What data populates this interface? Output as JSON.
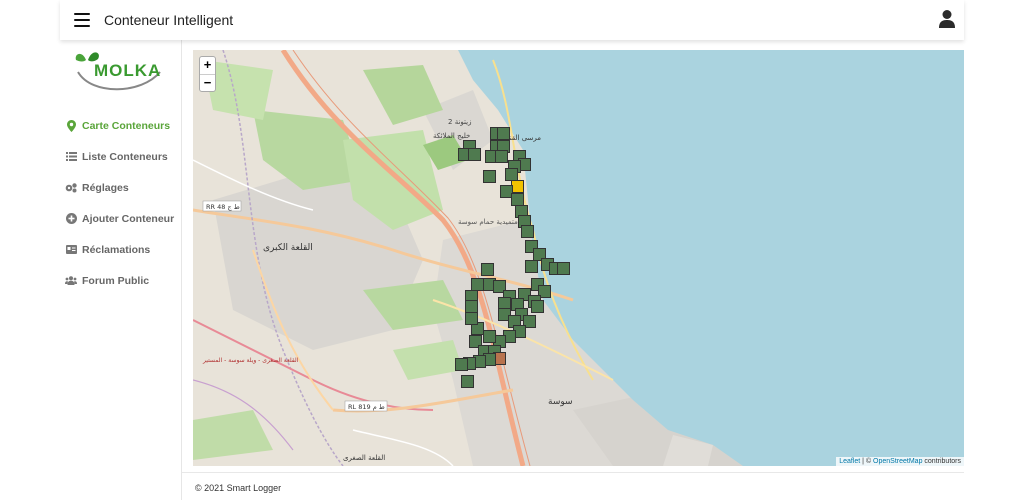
{
  "app": {
    "title": "Conteneur Intelligent"
  },
  "logo": {
    "text": "MOLKA"
  },
  "sidebar": {
    "items": [
      {
        "label": "Carte Conteneurs",
        "icon": "map-marker-icon",
        "active": true
      },
      {
        "label": "Liste Conteneurs",
        "icon": "list-icon",
        "active": false
      },
      {
        "label": "Réglages",
        "icon": "gears-icon",
        "active": false
      },
      {
        "label": "Ajouter Conteneur",
        "icon": "plus-circle-icon",
        "active": false
      },
      {
        "label": "Réclamations",
        "icon": "id-card-icon",
        "active": false
      },
      {
        "label": "Forum Public",
        "icon": "users-icon",
        "active": false
      }
    ]
  },
  "map": {
    "zoom_in": "+",
    "zoom_out": "−",
    "attribution": {
      "leaflet": "Leaflet",
      "sep": " | © ",
      "osm": "OpenStreetMap",
      "suffix": " contributors"
    },
    "labels": [
      {
        "text": "زيتونة 2",
        "cls": "place"
      },
      {
        "text": "خليج الملائكة",
        "cls": "place"
      },
      {
        "text": "متميدية حمام سوسة",
        "cls": "place"
      },
      {
        "text": "القلعة الكبرى",
        "cls": "place"
      },
      {
        "text": "RR 48 ط ج",
        "cls": "road"
      },
      {
        "text": "RL 819 ط م",
        "cls": "road"
      },
      {
        "text": "سوسة",
        "cls": "place"
      },
      {
        "text": "القلعة الصغرى",
        "cls": "place"
      },
      {
        "text": "القلعة الصغرى - ويلة سوسة - المستير",
        "cls": "road-red"
      },
      {
        "text": "مرسى القنطاوي",
        "cls": "place"
      }
    ],
    "status_colors": {
      "normal": "#4f7a4f",
      "warning": "#f2c200",
      "full": "#b8734e"
    }
  },
  "footer": {
    "text": "© 2021 Smart Logger"
  }
}
